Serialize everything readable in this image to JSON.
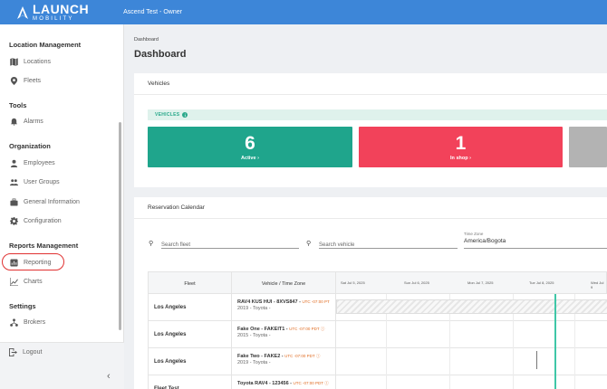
{
  "header": {
    "logo_main": "LAUNCH",
    "logo_sub": "MOBILITY",
    "account": "Ascend Test - Owner"
  },
  "sidebar": {
    "sections": [
      {
        "title": "Location Management",
        "items": [
          {
            "label": "Locations",
            "icon": "map-icon"
          },
          {
            "label": "Fleets",
            "icon": "location-pin-icon"
          }
        ]
      },
      {
        "title": "Tools",
        "items": [
          {
            "label": "Alarms",
            "icon": "alarm-bell-icon"
          }
        ]
      },
      {
        "title": "Organization",
        "items": [
          {
            "label": "Employees",
            "icon": "person-icon"
          },
          {
            "label": "User Groups",
            "icon": "group-icon"
          },
          {
            "label": "General Information",
            "icon": "briefcase-icon"
          },
          {
            "label": "Configuration",
            "icon": "gear-icon"
          }
        ]
      },
      {
        "title": "Reports Management",
        "items": [
          {
            "label": "Reporting",
            "icon": "report-icon"
          },
          {
            "label": "Charts",
            "icon": "chart-icon"
          }
        ]
      },
      {
        "title": "Settings",
        "items": [
          {
            "label": "Brokers",
            "icon": "network-icon"
          }
        ]
      }
    ],
    "logout": "Logout",
    "collapse_glyph": "‹"
  },
  "breadcrumb": "Dashboard",
  "page_title": "Dashboard",
  "vehicles_panel": {
    "title": "Vehicles",
    "section_label": "VEHICLES",
    "info_glyph": "i",
    "stats": [
      {
        "value": "6",
        "label": "Active",
        "color": "#1fa58c"
      },
      {
        "value": "1",
        "label": "In shop",
        "color": "#f2425a"
      },
      {
        "value": "",
        "label": "",
        "color": "#b3b3b3"
      }
    ]
  },
  "calendar_panel": {
    "title": "Reservation Calendar",
    "search_fleet_placeholder": "Search fleet",
    "search_vehicle_placeholder": "Search vehicle",
    "timezone_label": "Time Zone",
    "timezone_value": "America/Bogota",
    "columns": {
      "fleet": "Fleet",
      "vehicle": "Vehicle / Time Zone"
    },
    "days": [
      "Sat Jul 5, 2025",
      "Sun Jul 6, 2025",
      "Mon Jul 7, 2025",
      "Tue Jul 8, 2025",
      "Wed Jul 9"
    ],
    "rows": [
      {
        "fleet": "Los Angeles",
        "vehicle": "RAV4 KUS HUI - 8XVS847",
        "tz": "UTC -07:00 PT",
        "sub": "2019 - Toyota -"
      },
      {
        "fleet": "Los Angeles",
        "vehicle": "Fake One - FAKEIT1",
        "tz": "UTC -07:00 PDT ⓘ",
        "sub": "2015 - Toyota -"
      },
      {
        "fleet": "Los Angeles",
        "vehicle": "Fake Two - FAKE2",
        "tz": "UTC -07:00 PDT ⓘ",
        "sub": "2019 - Toyota -"
      },
      {
        "fleet": "Fleet Test",
        "vehicle": "Toyota RAV4 - 123456",
        "tz": "UTC -07:00 PDT ⓘ",
        "sub": ""
      }
    ]
  },
  "colors": {
    "topbar": "#3d86d8",
    "highlight": "#e03131",
    "accent_green": "#28a88a"
  }
}
